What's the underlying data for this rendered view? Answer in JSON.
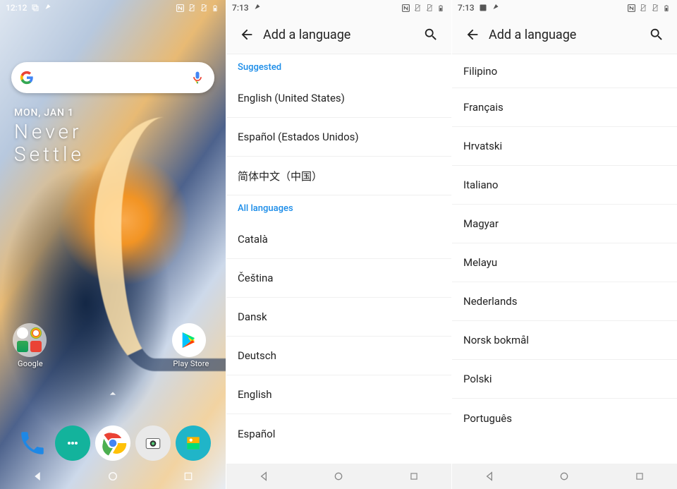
{
  "phone1": {
    "status": {
      "time": "12:12"
    },
    "date_line": "MON, JAN 1",
    "tagline1": "Never",
    "tagline2": "Settle",
    "google_folder_label": "Google",
    "playstore_label": "Play Store"
  },
  "phone2": {
    "status": {
      "time": "7:13"
    },
    "title": "Add a language",
    "header_suggested": "Suggested",
    "header_all": "All languages",
    "suggested": [
      "English (United States)",
      "Español (Estados Unidos)",
      "简体中文（中国）"
    ],
    "all": [
      "Català",
      "Čeština",
      "Dansk",
      "Deutsch",
      "English",
      "Español"
    ]
  },
  "phone3": {
    "status": {
      "time": "7:13"
    },
    "title": "Add a language",
    "items": [
      "Filipino",
      "Français",
      "Hrvatski",
      "Italiano",
      "Magyar",
      "Melayu",
      "Nederlands",
      "Norsk bokmål",
      "Polski",
      "Português"
    ]
  }
}
